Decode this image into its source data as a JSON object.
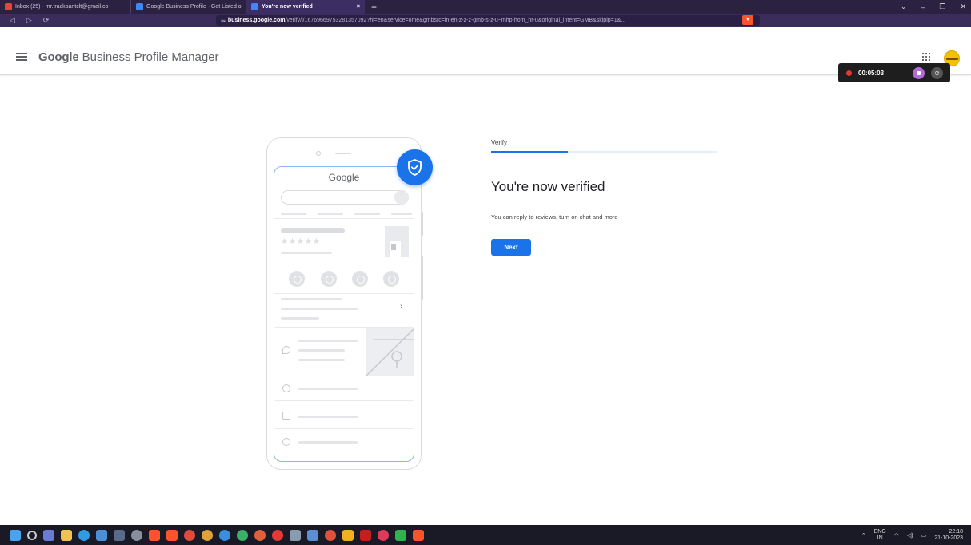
{
  "browser": {
    "tabs": [
      {
        "label": "Inbox (25) - mr.trackpantclt@gmail.co",
        "active": false
      },
      {
        "label": "Google Business Profile - Get Listed o",
        "active": false
      },
      {
        "label": "You're now verified",
        "active": true
      }
    ],
    "url_domain": "business.google.com",
    "url_path": "/verify/l/16769669753281357092?hl=en&service=ome&gmbsrc=in-en-z-z-z-gmb-s-z-u~mhp-hom_hr-u&original_intent=GMB&skiplp=1&..."
  },
  "header": {
    "brand_google": "Google",
    "brand_rest": " Business Profile Manager"
  },
  "recorder": {
    "time": "00:05:03"
  },
  "illustration": {
    "google_label": "Google",
    "stars": "★★★★★"
  },
  "verify": {
    "step_label": "Verify",
    "progress_fraction": 0.34,
    "headline": "You're now verified",
    "subtext": "You can reply to reviews, turn on chat and more",
    "next_label": "Next"
  },
  "taskbar": {
    "lang_top": "ENG",
    "lang_bottom": "IN",
    "time": "22:18",
    "date": "21-10-2023"
  },
  "colors": {
    "primary": "#1a73e8",
    "browser_chrome": "#2b2140"
  }
}
